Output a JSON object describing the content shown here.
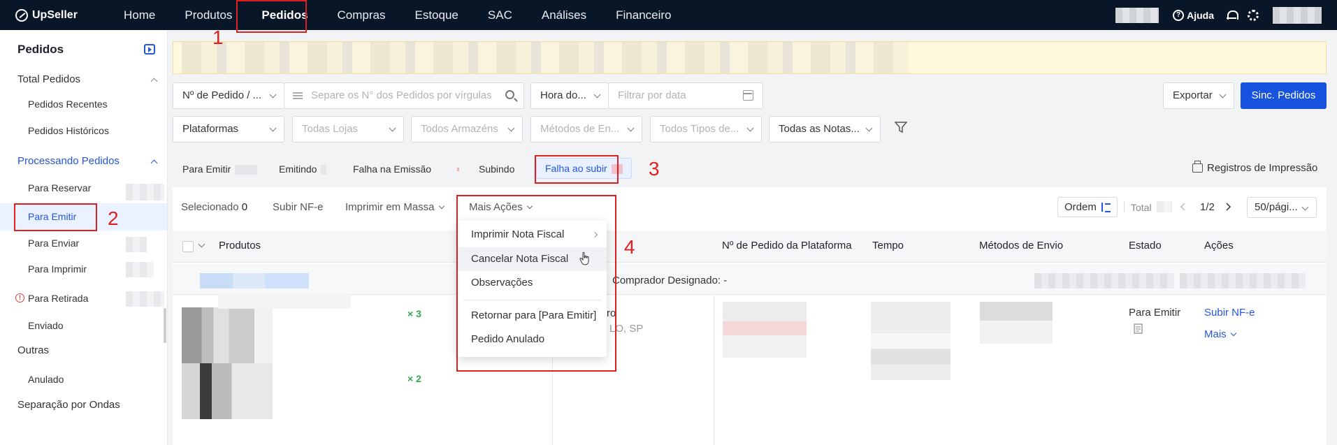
{
  "app": {
    "logo": "UpSeller"
  },
  "nav": {
    "items": [
      "Home",
      "Produtos",
      "Pedidos",
      "Compras",
      "Estoque",
      "SAC",
      "Análises",
      "Financeiro"
    ],
    "active": "Pedidos",
    "help_label": "Ajuda"
  },
  "sidebar": {
    "title": "Pedidos",
    "total_pedidos": "Total Pedidos",
    "pedidos_recentes": "Pedidos Recentes",
    "pedidos_historicos": "Pedidos Históricos",
    "processando": "Processando Pedidos",
    "para_reservar": "Para Reservar",
    "para_emitir": "Para Emitir",
    "para_enviar": "Para Enviar",
    "para_imprimir": "Para Imprimir",
    "para_retirada": "Para Retirada",
    "enviado": "Enviado",
    "outras": "Outras",
    "anulado": "Anulado",
    "separacao": "Separação por Ondas"
  },
  "filters": {
    "order_type": "Nº de Pedido / ...",
    "search_placeholder": "Separe os N° dos Pedidos por vírgulas",
    "time_select": "Hora do...",
    "date_placeholder": "Filtrar por data",
    "export": "Exportar",
    "sync": "Sinc. Pedidos",
    "plataformas": "Plataformas",
    "lojas": "Todas Lojas",
    "armazens": "Todos Armazéns",
    "metodos": "Métodos de En...",
    "tipos": "Todos Tipos de...",
    "notas": "Todas as Notas..."
  },
  "tabs": {
    "para_emitir": "Para Emitir",
    "emitindo": "Emitindo",
    "falha_emissao": "Falha na Emissão",
    "subindo": "Subindo",
    "falha_subir": "Falha ao subir",
    "print_records": "Registros de Impressão"
  },
  "toolbar": {
    "selecionado": "Selecionado",
    "selecionado_count": "0",
    "subir": "Subir NF-e",
    "imprimir_massa": "Imprimir em Massa",
    "mais_acoes": "Mais Ações",
    "ordem": "Ordem",
    "total": "Total",
    "page": "1/2",
    "per_page": "50/pági..."
  },
  "table": {
    "headers": {
      "produtos": "Produtos",
      "nr_plataforma": "Nº de Pedido da Plataforma",
      "tempo": "Tempo",
      "metodos": "Métodos de Envio",
      "estado": "Estado",
      "acoes": "Ações"
    },
    "buyer_label": "Comprador Designado: -",
    "row": {
      "qty1": "× 3",
      "qty2": "× 2",
      "address_partial": "ro",
      "city_partial": "LO, SP",
      "status": "Para Emitir",
      "action_primary": "Subir NF-e",
      "action_more": "Mais"
    }
  },
  "dropdown": {
    "items": [
      "Imprimir Nota Fiscal",
      "Cancelar Nota Fiscal",
      "Observações",
      "Retornar para [Para Emitir]",
      "Pedido Anulado"
    ]
  },
  "annotations": [
    "1",
    "2",
    "3",
    "4"
  ],
  "colors": {
    "primary": "#1853e0",
    "nav_bg": "#091628",
    "annotation": "#e02020",
    "qty_green": "#2fa84f"
  }
}
